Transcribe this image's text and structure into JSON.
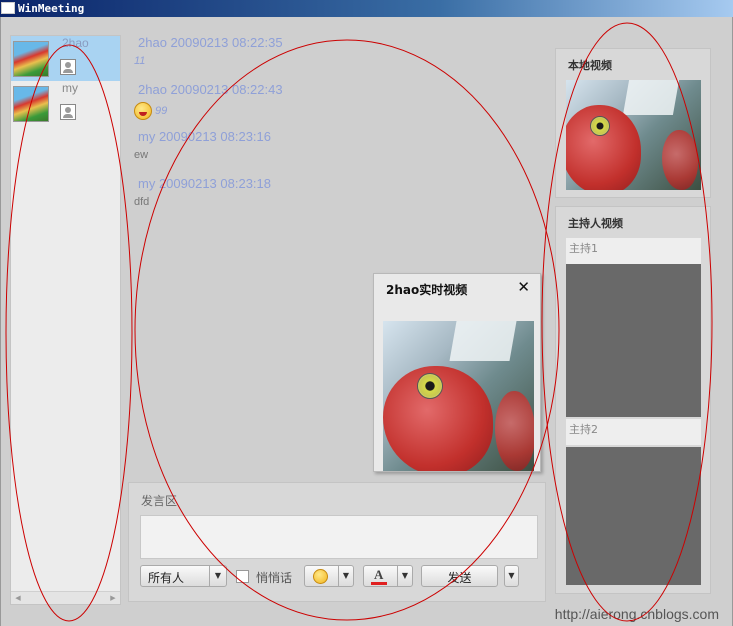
{
  "window": {
    "title": "WinMeeting"
  },
  "users": [
    {
      "name": "2hao",
      "selected": true
    },
    {
      "name": "my",
      "selected": false
    }
  ],
  "messages": [
    {
      "header": "2hao 20090213 08:22:35",
      "body": "11",
      "body_style": "blue"
    },
    {
      "header": "2hao 20090213 08:22:43",
      "body": "99",
      "body_style": "blue",
      "emoji": "laughing-emoji-icon"
    },
    {
      "header": "my 20090213 08:23:16",
      "body": "ew",
      "body_style": "plain"
    },
    {
      "header": "my 20090213 08:23:18",
      "body": "dfd",
      "body_style": "plain"
    }
  ],
  "video_popup": {
    "title": "2hao实时视频",
    "close": "✕"
  },
  "compose": {
    "label": "发言区",
    "input_value": "",
    "recipient_select": "所有人",
    "whisper_label": "悄悄话",
    "whisper_checked": false,
    "send_label": "发送"
  },
  "local_video": {
    "title": "本地视频"
  },
  "host_video": {
    "title": "主持人视频",
    "hosts": [
      {
        "label": "主持1"
      },
      {
        "label": "主持2"
      }
    ]
  },
  "watermark": "http://aierong.cnblogs.com",
  "colors": {
    "annotation": "#cc0000",
    "timestamp": "#8fa0d8",
    "selected_user": "#a9d3f2",
    "host_video_bg": "#696969"
  }
}
